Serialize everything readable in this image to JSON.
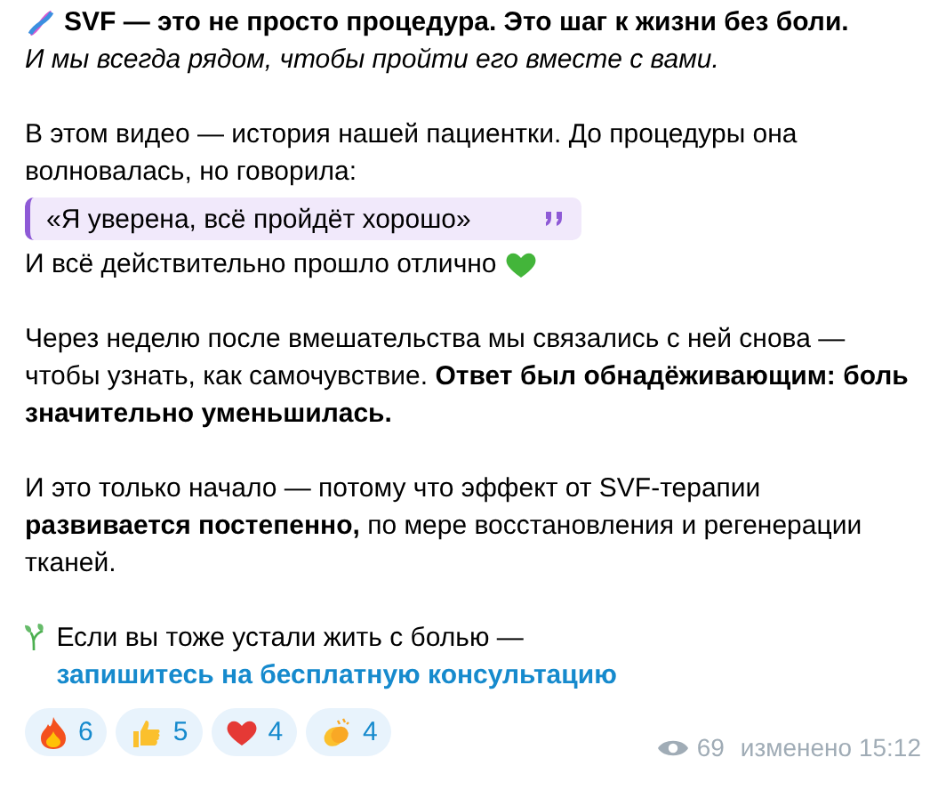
{
  "headline": "SVF — это не просто процедура. Это шаг к жизни без боли.",
  "subline": "И мы всегда рядом, чтобы пройти его вместе с вами.",
  "intro": "В этом видео — история нашей пациентки. До процедуры она волновалась, но говорила:",
  "quote": "«Я уверена, всё пройдёт хорошо»",
  "after_quote": "И всё действительно прошло отлично",
  "paragraphs": [
    "Через неделю после вмешательства мы связались с ней снова — чтобы узнать, как самочувствие. **Ответ был обнадёживающим: боль значительно уменьшилась.**",
    "И это только начало — потому что эффект от SVF-терапии **развивается постепенно,** по мере восстановления и регенерации тканей."
  ],
  "closing": {
    "text": "Если вы тоже устали жить с болью —",
    "link": "запишитесь на бесплатную консультацию"
  },
  "reactions": [
    {
      "kind": "fire",
      "count": "6"
    },
    {
      "kind": "thumbs",
      "count": "5"
    },
    {
      "kind": "heart",
      "count": "4"
    },
    {
      "kind": "clap",
      "count": "4"
    }
  ],
  "views": "69",
  "edited": "изменено 15:12"
}
